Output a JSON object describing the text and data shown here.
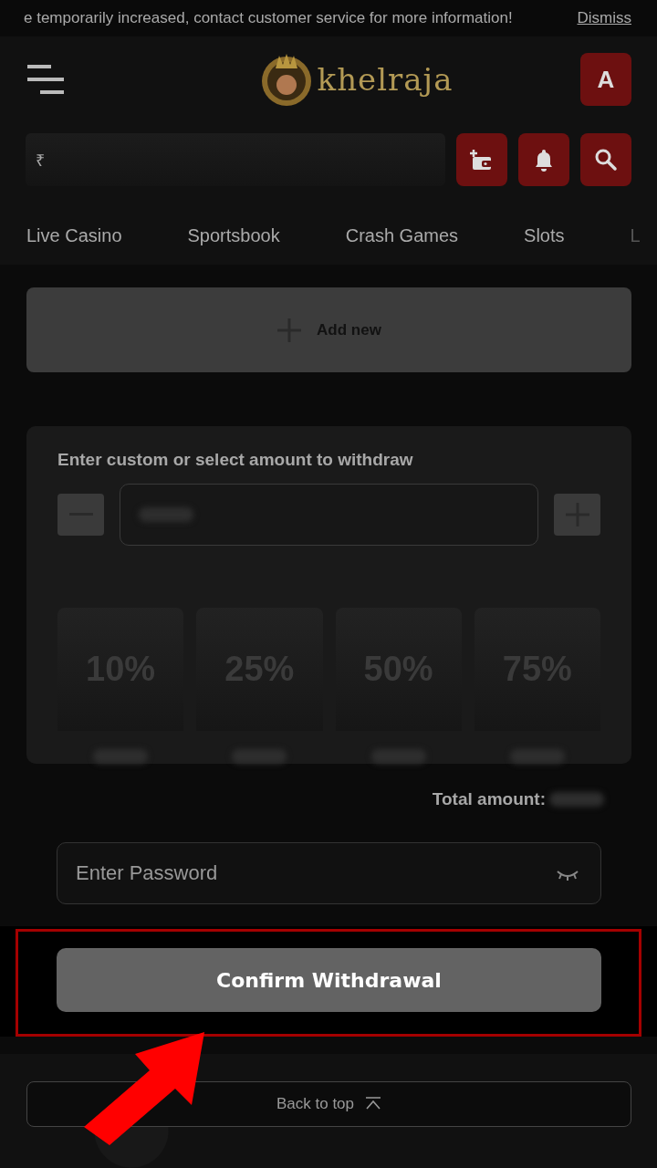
{
  "banner": {
    "message": "e temporarily increased, contact customer service for more information!",
    "action": "Dismiss"
  },
  "header": {
    "logo_text": "khelraja",
    "avatar_letter": "A"
  },
  "balance": {
    "currency": "₹"
  },
  "header_buttons": [
    {
      "kind": "wallet"
    },
    {
      "kind": "bell"
    },
    {
      "kind": "search"
    }
  ],
  "nav": [
    {
      "label": "Live Casino"
    },
    {
      "label": "Sportsbook"
    },
    {
      "label": "Crash Games"
    },
    {
      "label": "Slots"
    },
    {
      "label": "L"
    }
  ],
  "add_new": {
    "label": "Add new"
  },
  "amount": {
    "title": "Enter custom or select amount to withdraw",
    "presets": [
      {
        "label": "10%"
      },
      {
        "label": "25%"
      },
      {
        "label": "50%"
      },
      {
        "label": "75%"
      }
    ]
  },
  "total_label": "Total amount:",
  "password": {
    "placeholder": "Enter Password"
  },
  "confirm_button": "Confirm Withdrawal",
  "back_to_top": "Back to top"
}
